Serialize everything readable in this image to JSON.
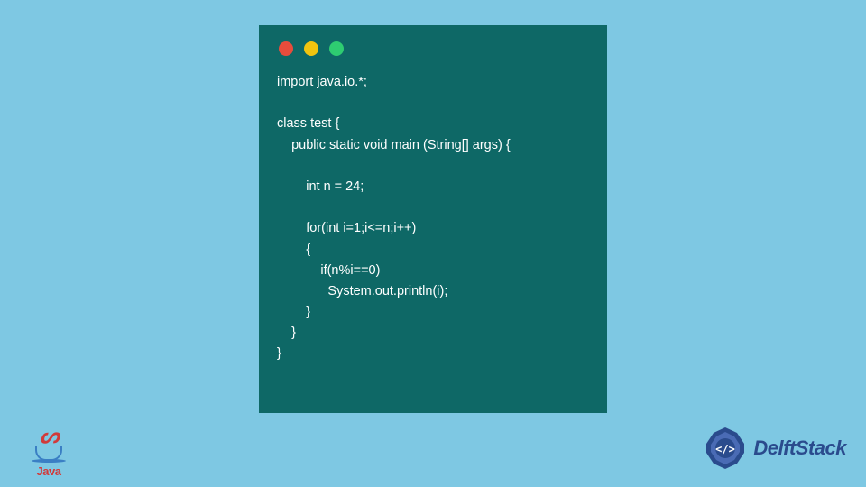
{
  "code_window": {
    "traffic_lights": [
      "red",
      "yellow",
      "green"
    ],
    "code": "import java.io.*;\n\nclass test {\n    public static void main (String[] args) {\n\n        int n = 24;\n\n        for(int i=1;i<=n;i++)\n        {\n            if(n%i==0)\n              System.out.println(i);\n        }\n    }\n}"
  },
  "java_logo": {
    "label": "Java"
  },
  "delft_logo": {
    "text": "DelftStack"
  }
}
